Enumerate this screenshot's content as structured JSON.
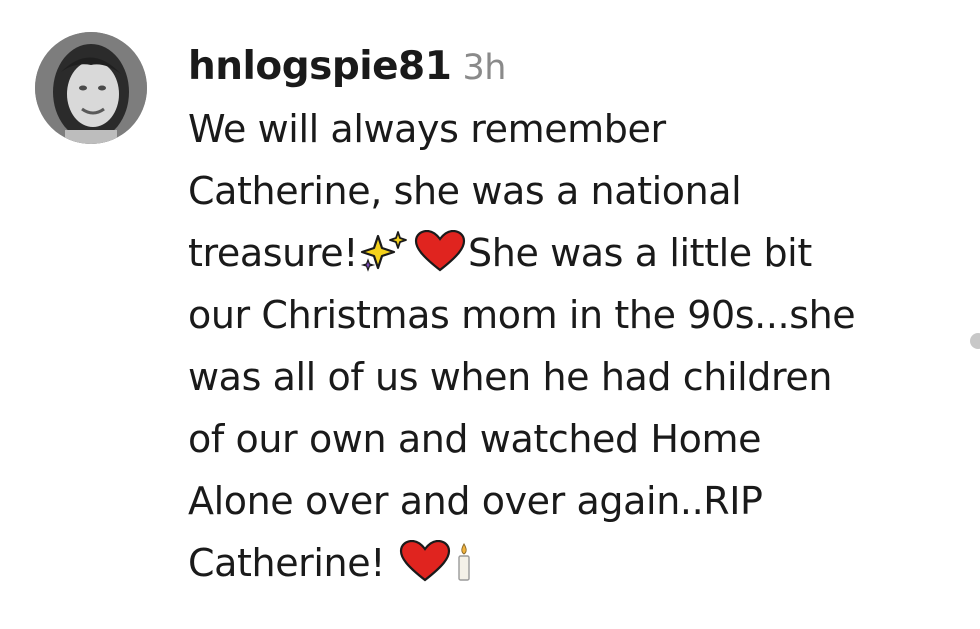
{
  "comment": {
    "username": "hnlogspie81",
    "timestamp": "3h",
    "lines": [
      "We will always remember",
      "Catherine, she was a national",
      "treasure!",
      "She was a little bit",
      "our Christmas mom in the 90s...she",
      "was all of us when he had children",
      "of our own and watched Home",
      "Alone over and over again..RIP",
      "Catherine!"
    ],
    "icons": [
      "sparkles-icon",
      "red-heart-icon",
      "red-heart-icon",
      "candle-icon"
    ]
  },
  "colors": {
    "text": "#1a1a1a",
    "timestamp": "#8a8a8a",
    "heart": "#e0241f"
  }
}
